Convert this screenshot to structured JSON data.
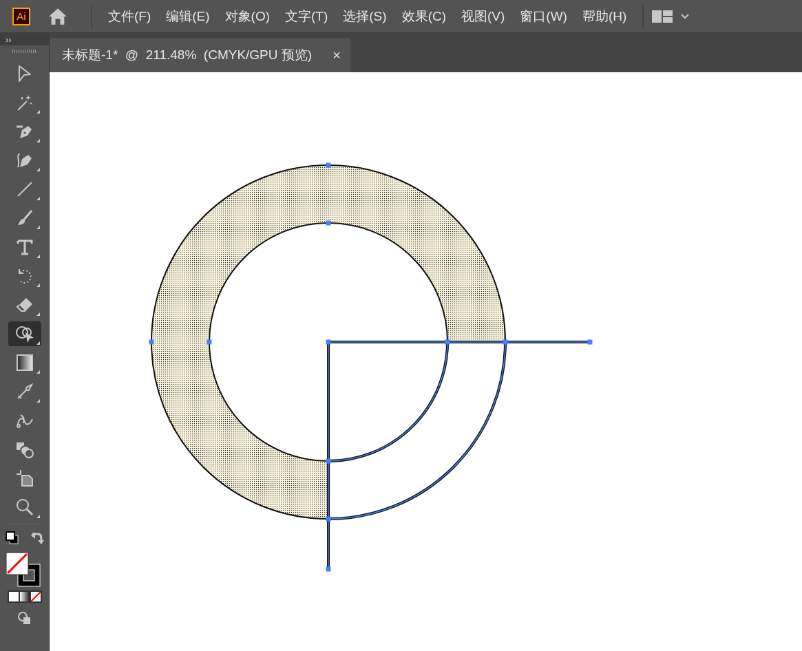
{
  "app": {
    "logo": "Ai"
  },
  "menu": [
    "文件(F)",
    "编辑(E)",
    "对象(O)",
    "文字(T)",
    "选择(S)",
    "效果(C)",
    "视图(V)",
    "窗口(W)",
    "帮助(H)"
  ],
  "toolbar": {
    "collapse": "››",
    "tools": [
      {
        "kind": "select",
        "selected": false,
        "flyout": false
      },
      {
        "kind": "wand",
        "selected": false,
        "flyout": true
      },
      {
        "kind": "pen",
        "selected": false,
        "flyout": true
      },
      {
        "kind": "curvature",
        "selected": false,
        "flyout": true
      },
      {
        "kind": "line",
        "selected": false,
        "flyout": true
      },
      {
        "kind": "brush",
        "selected": false,
        "flyout": true
      },
      {
        "kind": "type",
        "selected": false,
        "flyout": true
      },
      {
        "kind": "rotate",
        "selected": false,
        "flyout": true
      },
      {
        "kind": "eraser",
        "selected": false,
        "flyout": true
      },
      {
        "kind": "shapebuilder",
        "selected": true,
        "flyout": true
      },
      {
        "kind": "gradient",
        "selected": false,
        "flyout": true
      },
      {
        "kind": "eyedropper",
        "selected": false,
        "flyout": true
      },
      {
        "kind": "blend",
        "selected": false,
        "flyout": false
      },
      {
        "kind": "shapes",
        "selected": false,
        "flyout": false
      },
      {
        "kind": "artboard",
        "selected": false,
        "flyout": false
      },
      {
        "kind": "zoom",
        "selected": false,
        "flyout": true
      }
    ]
  },
  "document_tab": {
    "title": "未标题-1*  @  211.48%  (CMYK/GPU 预览)",
    "close": "×"
  }
}
